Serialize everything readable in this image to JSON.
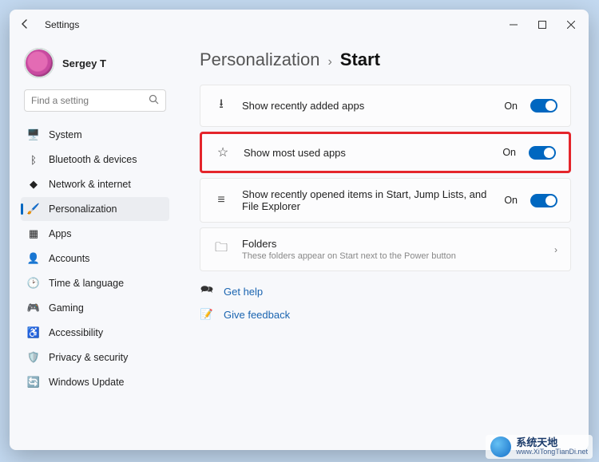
{
  "titlebar": {
    "title": "Settings"
  },
  "user": {
    "name": "Sergey T"
  },
  "search": {
    "placeholder": "Find a setting"
  },
  "sidebar": {
    "items": [
      {
        "label": "System",
        "icon": "display-icon",
        "glyph": "🖥️",
        "selected": false
      },
      {
        "label": "Bluetooth & devices",
        "icon": "bluetooth-icon",
        "glyph": "ᛒ",
        "selected": false
      },
      {
        "label": "Network & internet",
        "icon": "network-icon",
        "glyph": "◆",
        "selected": false
      },
      {
        "label": "Personalization",
        "icon": "personalization-icon",
        "glyph": "🖌️",
        "selected": true
      },
      {
        "label": "Apps",
        "icon": "apps-icon",
        "glyph": "▦",
        "selected": false
      },
      {
        "label": "Accounts",
        "icon": "accounts-icon",
        "glyph": "👤",
        "selected": false
      },
      {
        "label": "Time & language",
        "icon": "time-icon",
        "glyph": "🕑",
        "selected": false
      },
      {
        "label": "Gaming",
        "icon": "gaming-icon",
        "glyph": "🎮",
        "selected": false
      },
      {
        "label": "Accessibility",
        "icon": "accessibility-icon",
        "glyph": "♿",
        "selected": false
      },
      {
        "label": "Privacy & security",
        "icon": "privacy-icon",
        "glyph": "🛡️",
        "selected": false
      },
      {
        "label": "Windows Update",
        "icon": "update-icon",
        "glyph": "🔄",
        "selected": false
      }
    ]
  },
  "breadcrumb": {
    "parent": "Personalization",
    "current": "Start"
  },
  "settings": [
    {
      "icon": "download-icon",
      "glyph": "⭳",
      "label": "Show recently added apps",
      "sub": "",
      "state": "On",
      "toggle": true,
      "highlighted": false,
      "chevron": false
    },
    {
      "icon": "star-icon",
      "glyph": "☆",
      "label": "Show most used apps",
      "sub": "",
      "state": "On",
      "toggle": true,
      "highlighted": true,
      "chevron": false
    },
    {
      "icon": "list-icon",
      "glyph": "≡",
      "label": "Show recently opened items in Start, Jump Lists, and File Explorer",
      "sub": "",
      "state": "On",
      "toggle": true,
      "highlighted": false,
      "chevron": false
    },
    {
      "icon": "folder-icon",
      "glyph": "🗀",
      "label": "Folders",
      "sub": "These folders appear on Start next to the Power button",
      "state": "",
      "toggle": false,
      "highlighted": false,
      "chevron": true
    }
  ],
  "help": {
    "get_help": "Get help",
    "feedback": "Give feedback"
  },
  "watermark": {
    "cn": "系统天地",
    "en": "www.XiTongTianDi.net"
  }
}
